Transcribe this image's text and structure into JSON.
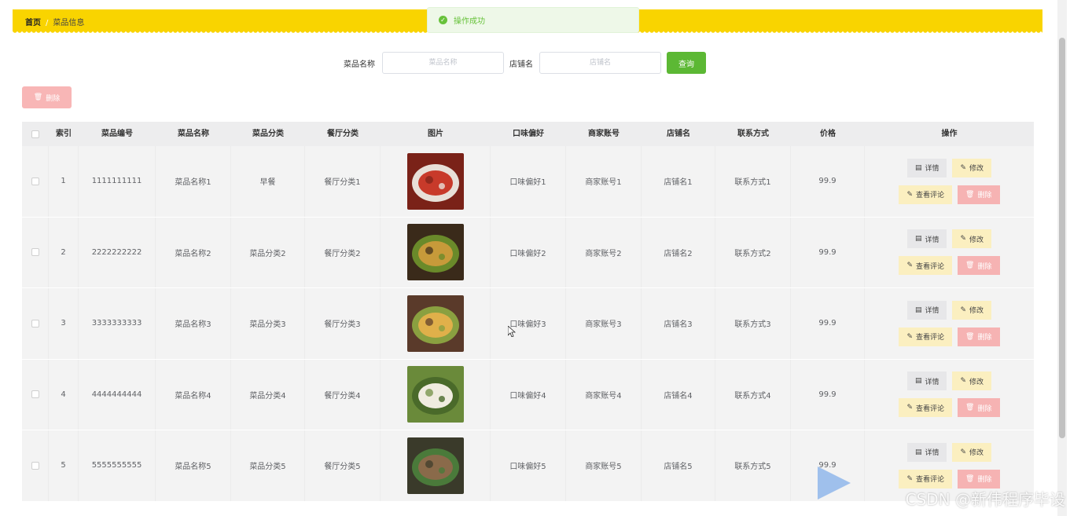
{
  "breadcrumb": {
    "home": "首页",
    "separator": "/",
    "current": "菜品信息"
  },
  "toast": {
    "message": "操作成功"
  },
  "search": {
    "name_label": "菜品名称",
    "name_placeholder": "菜品名称",
    "shop_label": "店铺名",
    "shop_placeholder": "店铺名",
    "query_label": "查询"
  },
  "delete_top_label": "删除",
  "table": {
    "headers": [
      "索引",
      "菜品编号",
      "菜品名称",
      "菜品分类",
      "餐厅分类",
      "图片",
      "口味偏好",
      "商家账号",
      "店铺名",
      "联系方式",
      "价格",
      "操作"
    ],
    "rows": [
      {
        "index": "1",
        "code": "1111111111",
        "name": "菜品名称1",
        "category": "早餐",
        "restaurant": "餐厅分类1",
        "taste": "口味偏好1",
        "account": "商家账号1",
        "shop": "店铺名1",
        "contact": "联系方式1",
        "price": "99.9"
      },
      {
        "index": "2",
        "code": "2222222222",
        "name": "菜品名称2",
        "category": "菜品分类2",
        "restaurant": "餐厅分类2",
        "taste": "口味偏好2",
        "account": "商家账号2",
        "shop": "店铺名2",
        "contact": "联系方式2",
        "price": "99.9"
      },
      {
        "index": "3",
        "code": "3333333333",
        "name": "菜品名称3",
        "category": "菜品分类3",
        "restaurant": "餐厅分类3",
        "taste": "口味偏好3",
        "account": "商家账号3",
        "shop": "店铺名3",
        "contact": "联系方式3",
        "price": "99.9"
      },
      {
        "index": "4",
        "code": "4444444444",
        "name": "菜品名称4",
        "category": "菜品分类4",
        "restaurant": "餐厅分类4",
        "taste": "口味偏好4",
        "account": "商家账号4",
        "shop": "店铺名4",
        "contact": "联系方式4",
        "price": "99.9"
      },
      {
        "index": "5",
        "code": "5555555555",
        "name": "菜品名称5",
        "category": "菜品分类5",
        "restaurant": "餐厅分类5",
        "taste": "口味偏好5",
        "account": "商家账号5",
        "shop": "店铺名5",
        "contact": "联系方式5",
        "price": "99.9"
      }
    ],
    "actions": {
      "detail": "详情",
      "edit": "修改",
      "comments": "查看评论",
      "delete": "删除"
    }
  },
  "watermark": "CSDN @新伟程序毕设",
  "colors": {
    "header_bar": "#f9d400",
    "query_button": "#5cb834",
    "success": "#67c23a",
    "danger_light": "#f6b3b3",
    "warning_light": "#fbefc0"
  }
}
